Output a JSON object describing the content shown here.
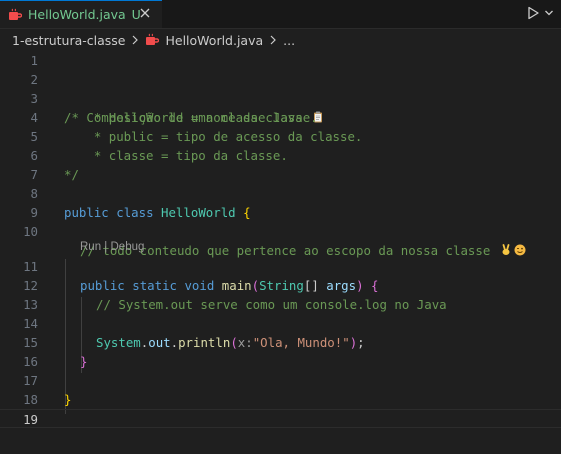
{
  "tab": {
    "filename": "HelloWorld.java",
    "modified_badge": "U"
  },
  "breadcrumb": {
    "folder": "1-estrutura-classe",
    "file": "HelloWorld.java",
    "more": "..."
  },
  "codelens": {
    "run": "Run",
    "sep": " | ",
    "debug": "Debug"
  },
  "line_numbers": [
    "1",
    "2",
    "3",
    "4",
    "5",
    "6",
    "7",
    "8",
    "9",
    "10",
    "11",
    "12",
    "13",
    "14",
    "15",
    "16",
    "17",
    "18",
    "19"
  ],
  "code": {
    "l3": "/* Composição de uma classe Java",
    "l4": "    * HelloWorld = nome da classe.",
    "l5": "    * public = tipo de acesso da classe.",
    "l6": "    * classe = tipo da classe.",
    "l7": "*/",
    "l8_kw1": "public",
    "l8_kw2": "class",
    "l8_name": "HelloWorld",
    "l8_brace": "{",
    "l10": "// todo conteudo que pertence ao escopo da nossa classe",
    "l11_kw1": "public",
    "l11_kw2": "static",
    "l11_kw3": "void",
    "l11_fn": "main",
    "l11_type": "String",
    "l11_arr": "[]",
    "l11_arg": "args",
    "l11_brace": "{",
    "l13": "// System.out serve como um console.log no Java",
    "l14_cls": "System",
    "l14_out": "out",
    "l14_fn": "println",
    "l14_hint": "x:",
    "l14_str": "\"Ola, Mundo!\"",
    "l16": "}",
    "l18": "}"
  },
  "icons": {
    "tab": "java-coffee-icon",
    "close": "close-icon",
    "run": "run-play-icon",
    "run_menu": "chevron-down-icon",
    "breadcrumb_sep": "chevron-right-icon",
    "clipboard_emoji": "clipboard-emoji-icon",
    "peace_emoji": "victory-hand-emoji-icon",
    "wink_emoji": "winking-face-emoji-icon"
  },
  "colors": {
    "accent": "#0078d4",
    "git_untracked": "#73c991",
    "comment": "#6a9955",
    "keyword": "#569cd6",
    "class": "#4ec9b0",
    "function": "#dcdcaa",
    "string": "#ce9178"
  }
}
